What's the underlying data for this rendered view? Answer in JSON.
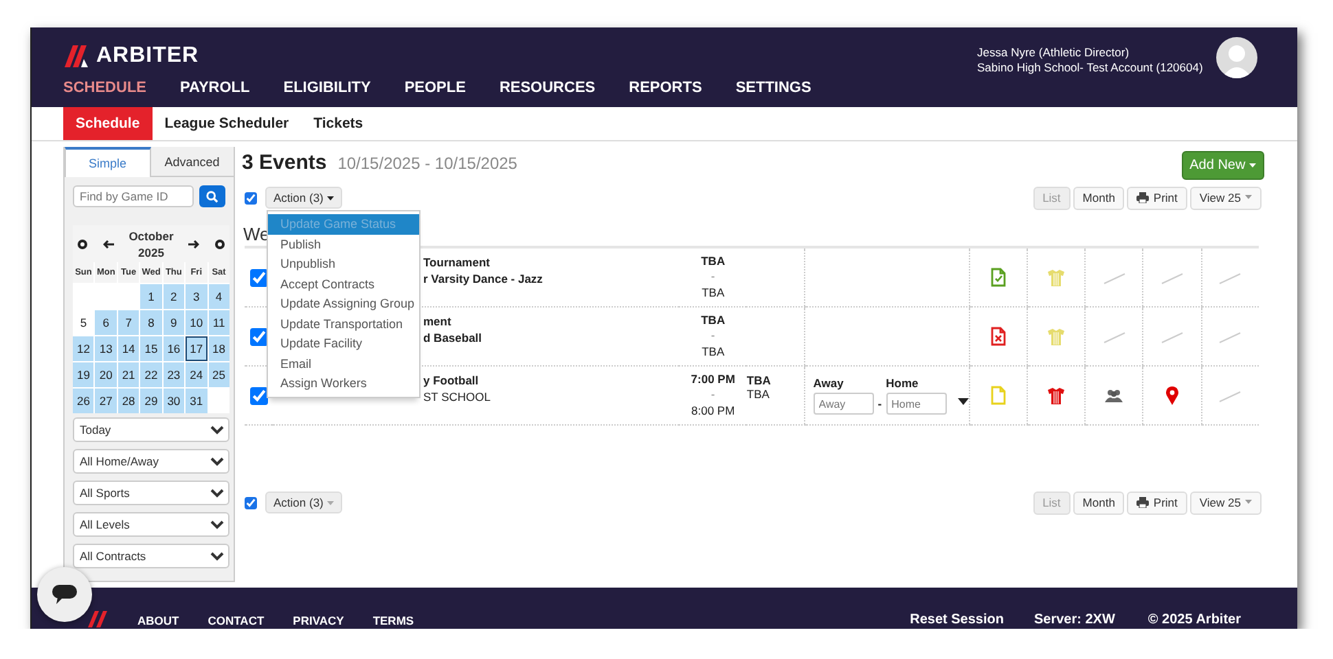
{
  "header": {
    "logo": "ARBITER",
    "nav": [
      {
        "label": "SCHEDULE",
        "selected": true
      },
      {
        "label": "PAYROLL",
        "selected": false
      },
      {
        "label": "ELIGIBILITY",
        "selected": false
      },
      {
        "label": "PEOPLE",
        "selected": false
      },
      {
        "label": "RESOURCES",
        "selected": false
      },
      {
        "label": "REPORTS",
        "selected": false
      },
      {
        "label": "SETTINGS",
        "selected": false
      }
    ],
    "user_name": "Jessa Nyre (Athletic Director)",
    "account": "Sabino High School- Test Account (120604)"
  },
  "subnav": [
    {
      "label": "Schedule",
      "selected": true
    },
    {
      "label": "League Scheduler",
      "selected": false
    },
    {
      "label": "Tickets",
      "selected": false
    }
  ],
  "sidebar": {
    "tabs": [
      {
        "label": "Simple",
        "selected": true
      },
      {
        "label": "Advanced",
        "selected": false
      }
    ],
    "search": {
      "placeholder": "Find by Game ID"
    },
    "calendar": {
      "month": "October",
      "year": "2025",
      "weekdays": [
        "Sun",
        "Mon",
        "Tue",
        "Wed",
        "Thu",
        "Fri",
        "Sat"
      ],
      "weeks": [
        [
          {
            "day": "1",
            "highlighted": true,
            "selected": false
          },
          {
            "day": "2",
            "highlighted": true,
            "selected": false
          },
          {
            "day": "3",
            "highlighted": true,
            "selected": false
          },
          {
            "day": "4",
            "highlighted": true,
            "selected": false
          }
        ],
        [
          {
            "day": "5",
            "highlighted": false,
            "selected": false
          },
          {
            "day": "6",
            "highlighted": true,
            "selected": false
          },
          {
            "day": "7",
            "highlighted": true,
            "selected": false
          },
          {
            "day": "8",
            "highlighted": true,
            "selected": false
          },
          {
            "day": "9",
            "highlighted": true,
            "selected": false
          },
          {
            "day": "10",
            "highlighted": true,
            "selected": false
          },
          {
            "day": "11",
            "highlighted": true,
            "selected": false
          }
        ],
        [
          {
            "day": "12",
            "highlighted": true,
            "selected": false
          },
          {
            "day": "13",
            "highlighted": true,
            "selected": false
          },
          {
            "day": "14",
            "highlighted": true,
            "selected": false
          },
          {
            "day": "15",
            "highlighted": true,
            "selected": false
          },
          {
            "day": "16",
            "highlighted": true,
            "selected": false
          },
          {
            "day": "17",
            "highlighted": true,
            "selected": true
          },
          {
            "day": "18",
            "highlighted": true,
            "selected": false
          }
        ],
        [
          {
            "day": "19",
            "highlighted": true,
            "selected": false
          },
          {
            "day": "20",
            "highlighted": true,
            "selected": false
          },
          {
            "day": "21",
            "highlighted": true,
            "selected": false
          },
          {
            "day": "22",
            "highlighted": true,
            "selected": false
          },
          {
            "day": "23",
            "highlighted": true,
            "selected": false
          },
          {
            "day": "24",
            "highlighted": true,
            "selected": false
          },
          {
            "day": "25",
            "highlighted": true,
            "selected": false
          }
        ],
        [
          {
            "day": "26",
            "highlighted": true,
            "selected": false
          },
          {
            "day": "27",
            "highlighted": true,
            "selected": false
          },
          {
            "day": "28",
            "highlighted": true,
            "selected": false
          },
          {
            "day": "29",
            "highlighted": true,
            "selected": false
          },
          {
            "day": "30",
            "highlighted": true,
            "selected": false
          },
          {
            "day": "31",
            "highlighted": true,
            "selected": false
          }
        ]
      ]
    },
    "filters": [
      "Today",
      "All Home/Away",
      "All Sports",
      "All Levels",
      "All Contracts"
    ]
  },
  "main": {
    "title": "3 Events",
    "date_range": "10/15/2025 - 10/15/2025",
    "add_button": "Add New",
    "select_all": true,
    "action_button": "Action (3)",
    "views": [
      {
        "label": "List",
        "selected": true
      },
      {
        "label": "Month",
        "selected": false
      },
      {
        "label": "Print",
        "selected": false
      },
      {
        "label": "View 25",
        "selected": false
      }
    ],
    "action_menu": [
      {
        "label": "Update Game Status",
        "selected": true
      },
      {
        "label": "Publish",
        "selected": false
      },
      {
        "label": "Unpublish",
        "selected": false
      },
      {
        "label": "Accept Contracts",
        "selected": false
      },
      {
        "label": "Update Assigning Group",
        "selected": false
      },
      {
        "label": "Update Transportation",
        "selected": false
      },
      {
        "label": "Update Facility",
        "selected": false
      },
      {
        "label": "Email",
        "selected": false
      },
      {
        "label": "Assign Workers",
        "selected": false
      }
    ],
    "group_heading": "We",
    "events": [
      {
        "checked": true,
        "title": "Tournament",
        "subtitle": "r Varsity Dance - Jazz",
        "subtitle_bold": true,
        "start": "TBA",
        "dash": "-",
        "end": "TBA",
        "icons": [
          {
            "kind": "doc-check",
            "color": "#5aa020"
          },
          {
            "kind": "shirt",
            "color": "#e6dc6e"
          },
          {
            "kind": "none"
          },
          {
            "kind": "none"
          },
          {
            "kind": "none"
          }
        ]
      },
      {
        "checked": true,
        "title": "ment",
        "subtitle": "d Baseball",
        "subtitle_bold": true,
        "start": "TBA",
        "dash": "-",
        "end": "TBA",
        "icons": [
          {
            "kind": "doc-x",
            "color": "#e02020"
          },
          {
            "kind": "shirt",
            "color": "#e6dc6e"
          },
          {
            "kind": "none"
          },
          {
            "kind": "none"
          },
          {
            "kind": "none"
          }
        ]
      },
      {
        "checked": true,
        "title": "y Football",
        "subtitle": "ST SCHOOL",
        "subtitle_bold": false,
        "start": "7:00 PM",
        "dash": "-",
        "end": "8:00 PM",
        "location": [
          "TBA",
          "TBA"
        ],
        "score": {
          "away_label": "Away",
          "away_placeholder": "Away",
          "home_label": "Home",
          "home_placeholder": "Home",
          "dash": "-"
        },
        "icons": [
          {
            "kind": "doc",
            "color": "#e8d21c"
          },
          {
            "kind": "shirt",
            "color": "#e01010"
          },
          {
            "kind": "people"
          },
          {
            "kind": "pin",
            "color": "#e00000"
          },
          {
            "kind": "none"
          }
        ]
      }
    ],
    "bottom_select_all": true,
    "bottom_action_button": "Action (3)",
    "bottom_views": [
      {
        "label": "List",
        "selected": true
      },
      {
        "label": "Month",
        "selected": false
      },
      {
        "label": "Print",
        "selected": false
      },
      {
        "label": "View 25",
        "selected": false
      }
    ]
  },
  "footer": {
    "links": [
      "ABOUT",
      "CONTACT",
      "PRIVACY",
      "TERMS"
    ],
    "reset": "Reset Session",
    "server": "Server: 2XW",
    "copyright": "© 2025 Arbiter"
  }
}
